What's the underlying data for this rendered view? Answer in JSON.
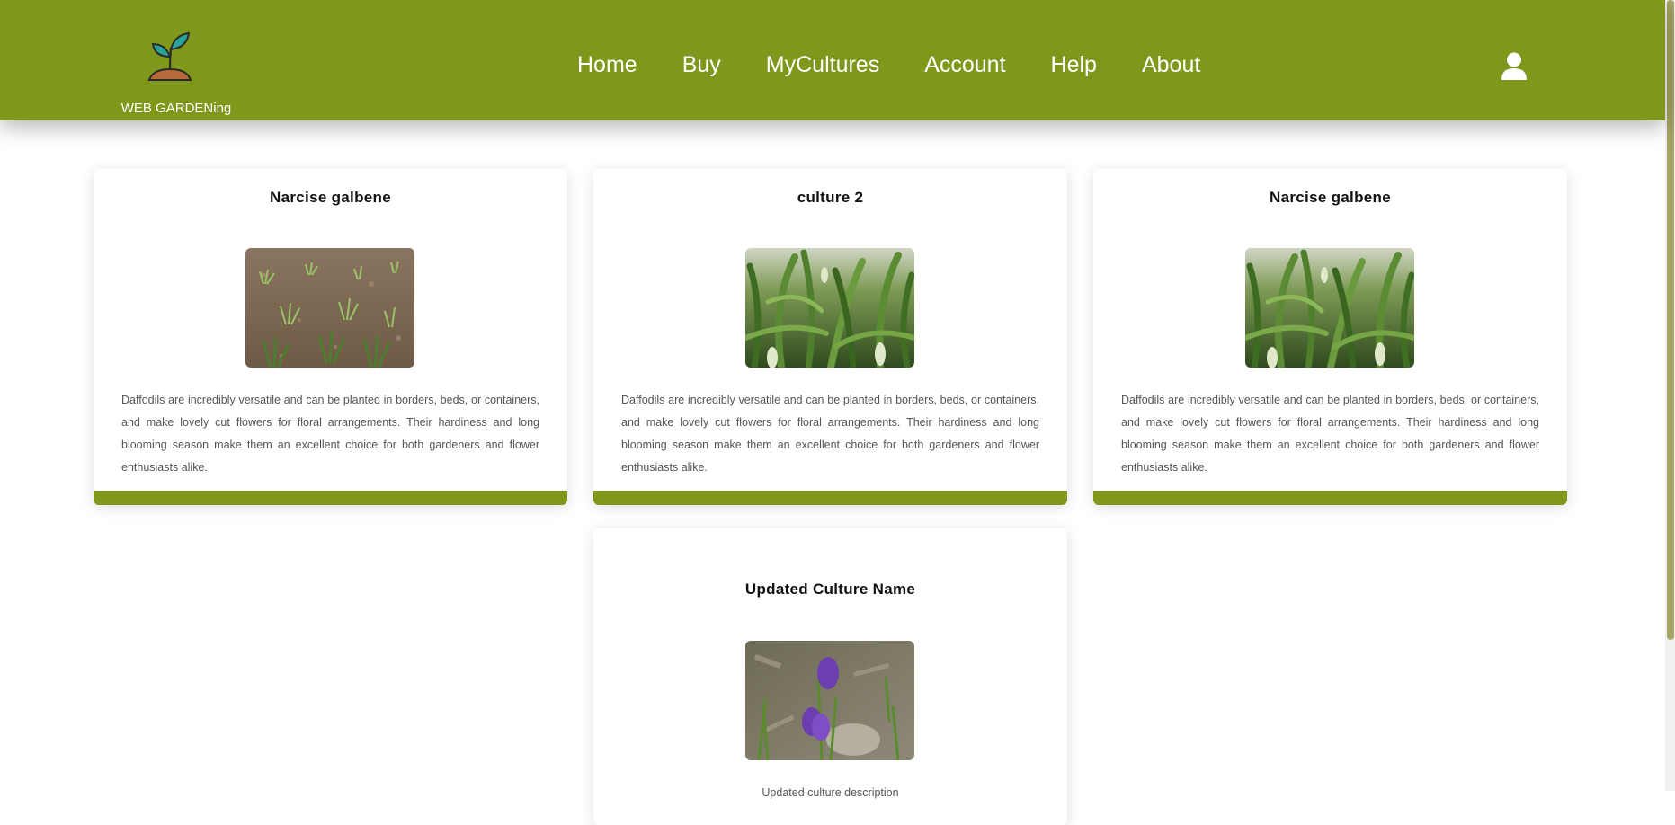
{
  "header": {
    "logo_text": "WEB GARDENing",
    "nav": [
      {
        "label": "Home"
      },
      {
        "label": "Buy"
      },
      {
        "label": "MyCultures"
      },
      {
        "label": "Account"
      },
      {
        "label": "Help"
      },
      {
        "label": "About"
      }
    ],
    "user_icon": "user-icon",
    "logo_icon": "sprout-icon"
  },
  "colors": {
    "brand_green": "#7f981c",
    "card_bar": "#7f981c",
    "scrollbar_thumb": "#a4a464"
  },
  "cards": [
    {
      "title": "Narcise galbene",
      "image": "sprouts-in-soil",
      "description": "Daffodils are incredibly versatile and can be planted in borders, beds, or containers, and make lovely cut flowers for floral arrangements. Their hardiness and long blooming season make them an excellent choice for both gardeners and flower enthusiasts alike."
    },
    {
      "title": "culture 2",
      "image": "green-lily-leaves",
      "description": "Daffodils are incredibly versatile and can be planted in borders, beds, or containers, and make lovely cut flowers for floral arrangements. Their hardiness and long blooming season make them an excellent choice for both gardeners and flower enthusiasts alike."
    },
    {
      "title": "Narcise galbene",
      "image": "green-lily-leaves",
      "description": "Daffodils are incredibly versatile and can be planted in borders, beds, or containers, and make lovely cut flowers for floral arrangements. Their hardiness and long blooming season make them an excellent choice for both gardeners and flower enthusiasts alike."
    },
    {
      "title": "Updated Culture Name",
      "image": "purple-crocus",
      "description": "Updated culture description"
    }
  ]
}
